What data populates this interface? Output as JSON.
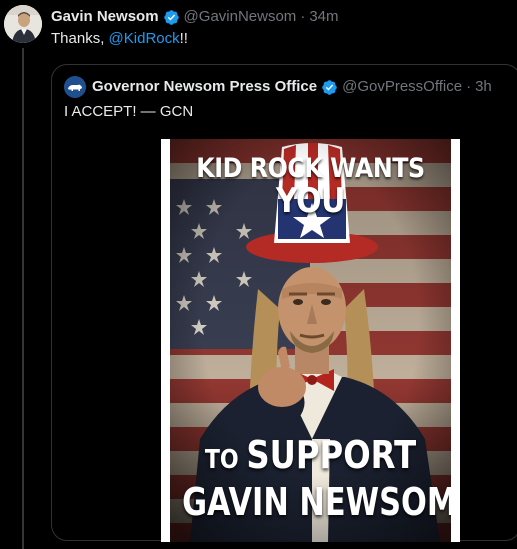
{
  "tweet": {
    "author_name": "Gavin Newsom",
    "handle": "@GavinNewsom",
    "separator": "·",
    "time": "34m",
    "text_prefix": "Thanks, ",
    "mention": "@KidRock",
    "text_suffix": "!!",
    "avatar_icon": "person-photo-avatar"
  },
  "quote": {
    "author_name": "Governor Newsom Press Office",
    "handle": "@GovPressOffice",
    "separator": "·",
    "time": "3h",
    "text": "I ACCEPT! — GCN",
    "avatar_icon": "bear-logo-avatar",
    "poster": {
      "line1_a": "KID ROCK WANTS ",
      "line1_b": "YOU",
      "line2_a": "TO ",
      "line2_b": "SUPPORT",
      "line3": "GAVIN NEWSOM"
    }
  },
  "colors": {
    "background": "#000000",
    "text": "#e7e9ea",
    "muted": "#71767b",
    "link": "#1d9bf0",
    "verified": "#1d9bf0",
    "border": "#2f3336"
  }
}
